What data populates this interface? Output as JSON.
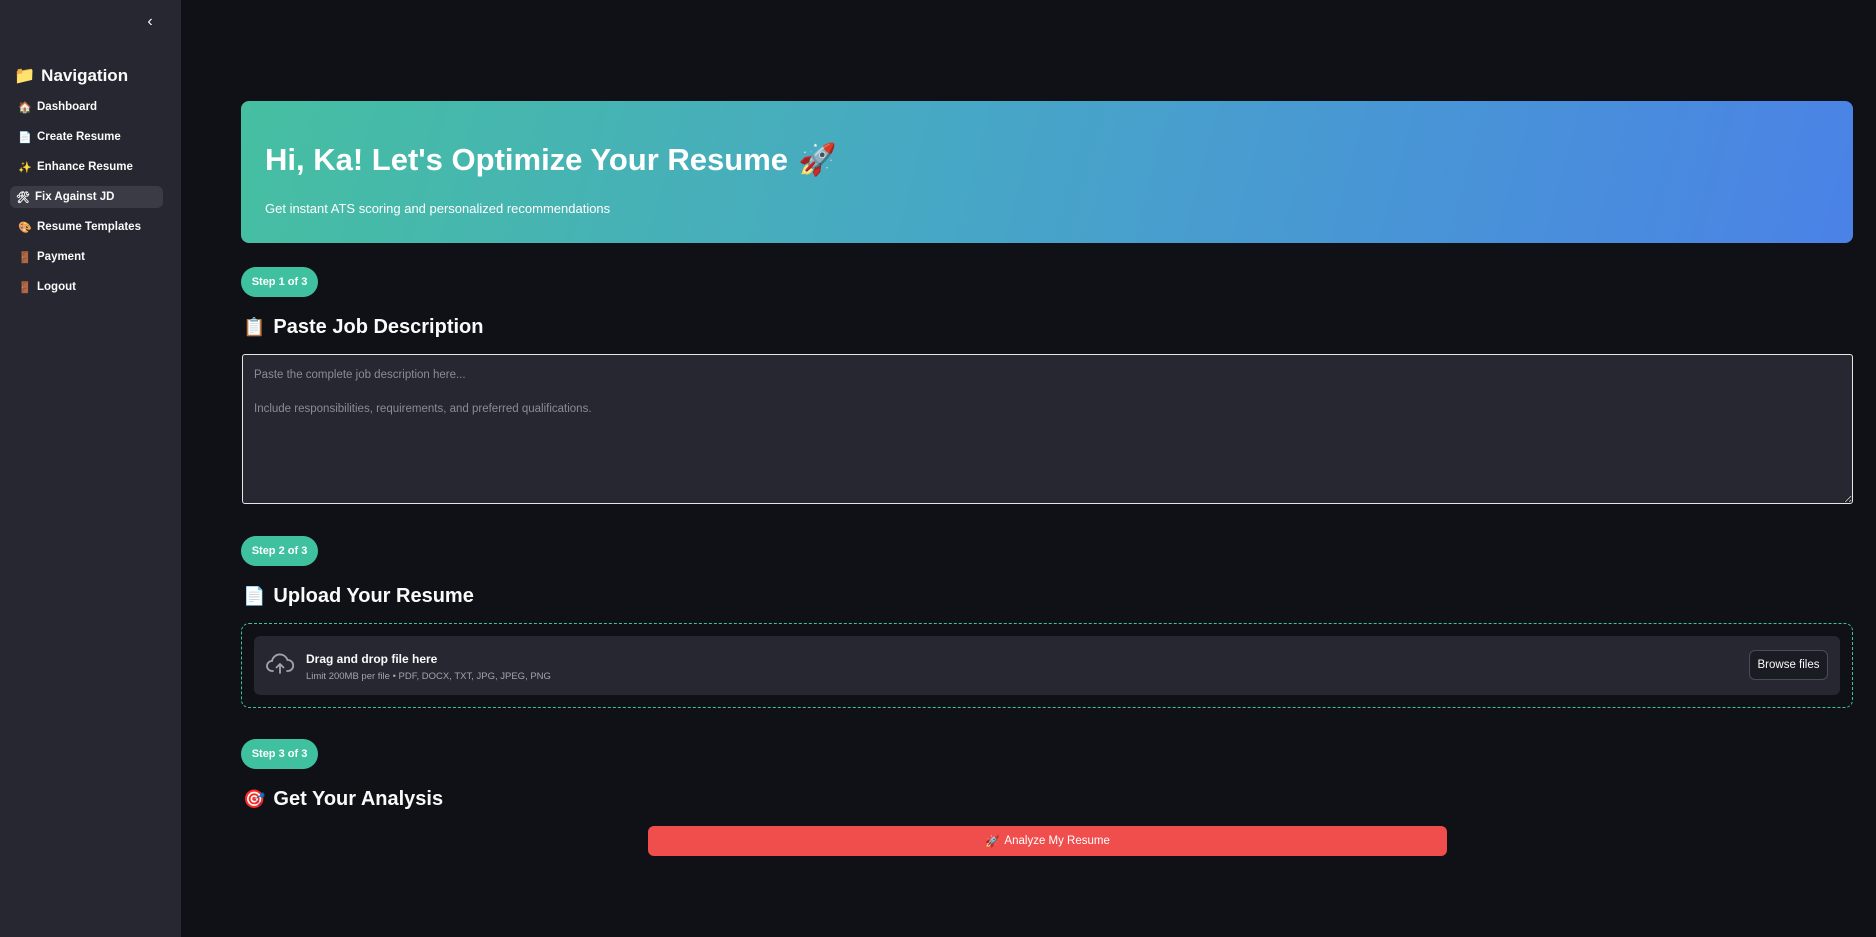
{
  "sidebar": {
    "collapse_icon": "chevron-left-icon",
    "collapse_glyph": "‹",
    "nav_title": "Navigation",
    "nav_title_emoji": "📁",
    "items": [
      {
        "emoji": "🏠",
        "label": "Dashboard",
        "active": false
      },
      {
        "emoji": "📄",
        "label": "Create Resume",
        "active": false
      },
      {
        "emoji": "✨",
        "label": "Enhance Resume",
        "active": false
      },
      {
        "emoji": "🛠",
        "label": "Fix Against JD",
        "active": true
      },
      {
        "emoji": "🎨",
        "label": "Resume Templates",
        "active": false
      },
      {
        "emoji": "🚪",
        "label": "Payment",
        "active": false
      },
      {
        "emoji": "🚪",
        "label": "Logout",
        "active": false
      }
    ]
  },
  "hero": {
    "title": "Hi, Ka! Let's Optimize Your Resume",
    "title_emoji": "🚀",
    "subtitle": "Get instant ATS scoring and personalized recommendations"
  },
  "steps": [
    {
      "badge": "Step 1 of 3",
      "emoji": "📋",
      "title": "Paste Job Description"
    },
    {
      "badge": "Step 2 of 3",
      "emoji": "📄",
      "title": "Upload Your Resume"
    },
    {
      "badge": "Step 3 of 3",
      "emoji": "🎯",
      "title": "Get Your Analysis"
    }
  ],
  "job_description": {
    "value": "",
    "placeholder": "Paste the complete job description here...\n\nInclude responsibilities, requirements, and preferred qualifications."
  },
  "uploader": {
    "icon": "cloud-upload-icon",
    "title": "Drag and drop file here",
    "limit": "Limit 200MB per file • PDF, DOCX, TXT, JPG, JPEG, PNG",
    "browse_label": "Browse files"
  },
  "analyze_button": {
    "emoji": "🚀",
    "label": "Analyze My Resume"
  },
  "colors": {
    "sidebar_bg": "#262730",
    "page_bg": "#0f1116",
    "accent_teal": "#3fc1a0",
    "primary_red": "#f04d4d",
    "hero_gradient_start": "#46bfa1",
    "hero_gradient_end": "#4a82e6"
  }
}
